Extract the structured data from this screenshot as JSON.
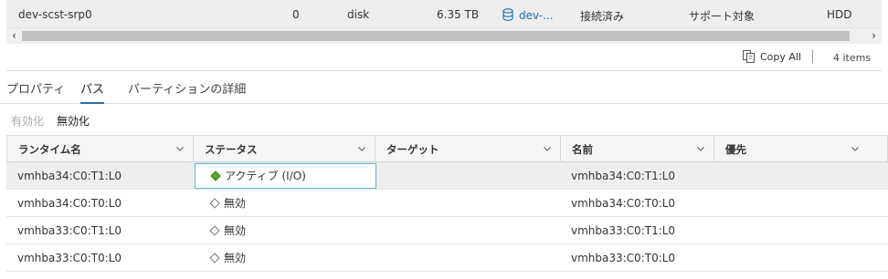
{
  "device_row": {
    "name": "dev-scst-srp0",
    "lun": "0",
    "type": "disk",
    "capacity": "6.35 TB",
    "datastore": "dev-...",
    "operational_state": "接続済み",
    "hardware_acceleration": "サポート対象",
    "drive_type": "HDD"
  },
  "scrollbar": {
    "left_arrow": "‹",
    "right_arrow": "›"
  },
  "footer": {
    "copy_all": "Copy All",
    "item_count": "4 items"
  },
  "tabs": [
    {
      "label": "プロパティ",
      "active": false
    },
    {
      "label": "パス",
      "active": true
    },
    {
      "label": "パーティションの詳細",
      "active": false
    }
  ],
  "actions": {
    "enable": "有効化",
    "disable": "無効化"
  },
  "grid": {
    "columns": [
      "ランタイム名",
      "ステータス",
      "ターゲット",
      "名前",
      "優先"
    ],
    "rows": [
      {
        "runtime_name": "vmhba34:C0:T1:L0",
        "status": "アクティブ (I/O)",
        "status_kind": "active",
        "target": "",
        "name": "vmhba34:C0:T1:L0",
        "preferred": ""
      },
      {
        "runtime_name": "vmhba34:C0:T0:L0",
        "status": "無効",
        "status_kind": "disabled",
        "target": "",
        "name": "vmhba34:C0:T0:L0",
        "preferred": ""
      },
      {
        "runtime_name": "vmhba33:C0:T1:L0",
        "status": "無効",
        "status_kind": "disabled",
        "target": "",
        "name": "vmhba33:C0:T1:L0",
        "preferred": ""
      },
      {
        "runtime_name": "vmhba33:C0:T0:L0",
        "status": "無効",
        "status_kind": "disabled",
        "target": "",
        "name": "vmhba33:C0:T0:L0",
        "preferred": ""
      }
    ]
  },
  "colors": {
    "active_status": "#5aa624",
    "link": "#1a6fae",
    "tab_underline": "#2f6fa8",
    "focus_border": "#5ab4d4"
  },
  "icons": {
    "datastore": "database-icon",
    "copy": "copy-icon",
    "column_menu": "chevron-down-icon",
    "status_active": "diamond-filled-icon",
    "status_disabled": "diamond-outline-icon"
  }
}
